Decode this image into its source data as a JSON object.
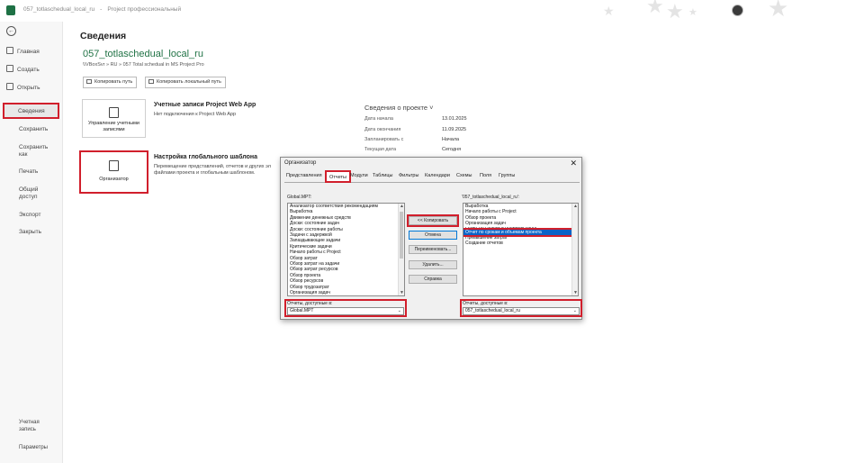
{
  "titlebar": {
    "filename": "057_totlaschedual_local_ru",
    "separator": "-",
    "app_name": "Project профессиональный"
  },
  "sidebar": {
    "items": [
      {
        "label": "Главная",
        "icon": "home-icon"
      },
      {
        "label": "Создать",
        "icon": "new-file-icon"
      },
      {
        "label": "Открыть",
        "icon": "folder-open-icon"
      },
      {
        "label": "Сведения",
        "icon": "none"
      },
      {
        "label": "Сохранить",
        "icon": "none"
      },
      {
        "label": "Сохранить как",
        "icon": "none"
      },
      {
        "label": "Печать",
        "icon": "none"
      },
      {
        "label": "Общий доступ",
        "icon": "none"
      },
      {
        "label": "Экспорт",
        "icon": "none"
      },
      {
        "label": "Закрыть",
        "icon": "none"
      }
    ],
    "bottom": [
      {
        "label": "Учетная запись"
      },
      {
        "label": "Параметры"
      }
    ]
  },
  "main": {
    "heading": "Сведения",
    "file_name": "057_totlaschedual_local_ru",
    "file_path": "\\\\VBoxSvr » RU » 057 Total schedual in MS Project Pro",
    "copy_path_label": "Копировать путь",
    "copy_local_path_label": "Копировать локальный путь",
    "accounts_tile_label": "Управление учетными записями",
    "pwa_title": "Учетные записи Project Web App",
    "pwa_text": "Нет подключения к Project Web App",
    "organizer_tile_label": "Организатор",
    "template_title": "Настройка глобального шаблона",
    "template_text_1": "Перемещение представлений, отчетов и других эл",
    "template_text_2": "файлами проекта и глобальным шаблоном."
  },
  "project_info": {
    "title": "Сведения о проекте ˅",
    "rows": [
      {
        "label": "Дата начала",
        "value": "13.01.2025"
      },
      {
        "label": "Дата окончания",
        "value": "11.09.2025"
      },
      {
        "label": "Запланировать с",
        "value": "Начала"
      },
      {
        "label": "Текущая дата",
        "value": "Сегодня"
      }
    ]
  },
  "dialog": {
    "title": "Организатор",
    "close": "✕",
    "tabs": [
      "Представления",
      "Отчеты",
      "Модули",
      "Таблицы",
      "Фильтры",
      "Календари",
      "Схемы",
      "Поля",
      "Группы"
    ],
    "left_label": "Global.MPT:",
    "right_label": "'057_totlaschedual_local_ru':",
    "left_items": [
      "Анализатор соответствия рекомендациям",
      "Выработка",
      "Движение денежных средств",
      "Доски: состояние задач",
      "Доски: состояние работы",
      "Задачи с задержкой",
      "Запаздывающие задачи",
      "Критические задачи",
      "Начало работы с Project",
      "Обзор затрат",
      "Обзор затрат на задачи",
      "Обзор затрат ресурсов",
      "Обзор проекта",
      "Обзор ресурсов",
      "Обзор трудозатрат",
      "Организация задач"
    ],
    "right_items": [
      "Выработка",
      "Начало работы с Project",
      "Обзор проекта",
      "Организация задач",
      "Отчет по срокам и объемам работ",
      "Отчет по срокам и объемам проекта",
      "Превышение затрат",
      "Создание отчетов"
    ],
    "right_selected_index": 5,
    "buttons": {
      "copy": "<< Копировать",
      "cancel": "Отмена",
      "rename": "Переименовать...",
      "delete": "Удалить...",
      "help": "Справка"
    },
    "left_available_label": "Отчеты, доступные в:",
    "left_available_value": "Global.MPT",
    "right_available_label": "Отчеты, доступные в:",
    "right_available_value": "057_totlaschedual_local_ru"
  },
  "colors": {
    "accent_green": "#217346",
    "highlight_red": "#d11f2c",
    "selection_blue": "#0a63c7"
  }
}
